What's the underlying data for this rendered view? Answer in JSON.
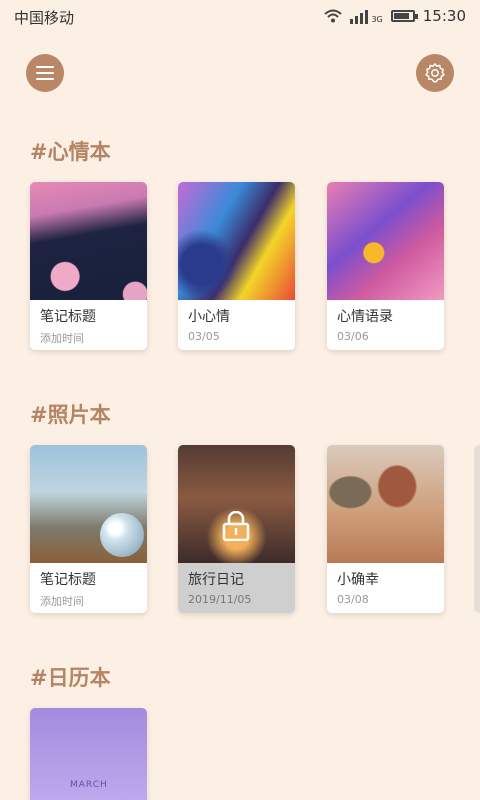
{
  "status_bar": {
    "carrier": "中国移动",
    "network": "3G",
    "time": "15:30"
  },
  "header": {
    "menu_icon": "hamburger-menu-icon",
    "settings_icon": "gear-icon",
    "accent_color": "#b98666"
  },
  "sections": [
    {
      "title": "#心情本",
      "cards": [
        {
          "title": "笔记标题",
          "date": "添加时间"
        },
        {
          "title": "小心情",
          "date": "03/05"
        },
        {
          "title": "心情语录",
          "date": "03/06"
        }
      ]
    },
    {
      "title": "#照片本",
      "cards": [
        {
          "title": "笔记标题",
          "date": "添加时间"
        },
        {
          "title": "旅行日记",
          "date": "2019/11/05",
          "locked": true
        },
        {
          "title": "小确幸",
          "date": "03/08"
        }
      ]
    },
    {
      "title": "#日历本",
      "cards": [
        {
          "cover_text": "MARCH"
        }
      ]
    }
  ]
}
